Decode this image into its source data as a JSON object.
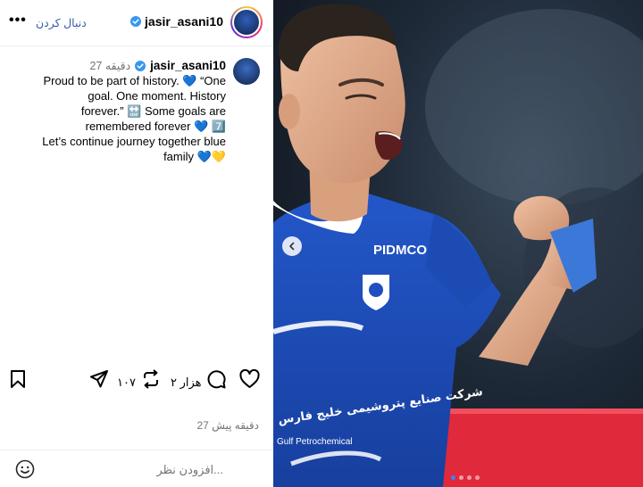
{
  "header": {
    "username": "jasir_asani10",
    "follow_label": "دنبال کردن",
    "more_label": "•••"
  },
  "caption": {
    "username": "jasir_asani10",
    "time": "27 دقیقه",
    "lines": [
      "Proud to be part of history. 💙 “One",
      "goal. One moment. History",
      "forever.” 🔛 Some goals are",
      "remembered forever 💙 7️⃣",
      "Let’s continue journey together blue",
      "family 💙💛"
    ]
  },
  "actions": {
    "likes_count": "۲ هزار",
    "reposts_count": "۱۰۷"
  },
  "posted_ago": "27 دقیقه پیش",
  "comment": {
    "placeholder": "افزودن نظر..."
  },
  "media": {
    "jersey_sponsor": "PIDMCO",
    "jersey_text_arabic": "شرکت صنایع پتروشیمی خلیج فارس",
    "jersey_text_english": "Gulf Petrochemical",
    "carousel_dots": 4,
    "active_dot": 0
  },
  "colors": {
    "follow": "#3d5aa8",
    "verified": "#3897f0",
    "jersey": "#1f4fc0",
    "accent_red": "#e0293a"
  },
  "icons": [
    "more-icon",
    "verified-icon",
    "like-icon",
    "comment-icon",
    "repost-icon",
    "share-icon",
    "bookmark-icon",
    "emoji-icon",
    "chevron-left-icon"
  ]
}
